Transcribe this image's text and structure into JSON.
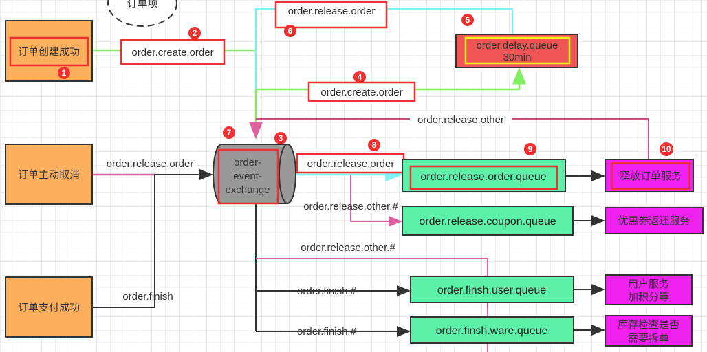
{
  "colors": {
    "producer": "#fbae5c",
    "queue": "#5cf0a8",
    "delay_queue": "#f05555",
    "service": "#f020f0",
    "exchange": "#999999",
    "highlight": "#f03030",
    "create_line": "#7fef5f",
    "release_line": "#7ff0f0",
    "other_line": "#e060a0"
  },
  "order_item": "订单项",
  "producers": [
    {
      "label": "订单创建成功",
      "badge": "1"
    },
    {
      "label": "订单主动取消"
    },
    {
      "label": "订单支付成功"
    }
  ],
  "exchange": {
    "line1": "order-",
    "line2": "event-",
    "line3": "exchange",
    "badge_left": "7",
    "badge_right": "3"
  },
  "delay_queue": {
    "line1": "order.delay.queue",
    "line2": "30min",
    "badge": "5"
  },
  "routes": {
    "create_from_producer": {
      "label": "order.create.order",
      "badge": "2"
    },
    "create_to_delay": {
      "label": "order.create.order",
      "badge": "4"
    },
    "delay_release": {
      "label": "order.release.order",
      "badge": "6"
    },
    "release_other_top": "order.release.other",
    "cancel_release": "order.release.order",
    "finish": "order.finish",
    "exchange_release": {
      "label": "order.release.order",
      "badge": "8"
    },
    "release_other_1": "order.release.other.#",
    "release_other_2": "order.release.other.#",
    "finish_user": "order.finish.#",
    "finish_ware": "order.finish.#"
  },
  "queues": [
    {
      "label": "order.release.order.queue",
      "badge": "9"
    },
    {
      "label": "order.release.coupon.queue"
    },
    {
      "label": "order.finsh.user.queue"
    },
    {
      "label": "order.finsh.ware.queue"
    }
  ],
  "services": [
    {
      "label": "释放订单服务",
      "badge": "10"
    },
    {
      "label": "优惠券返还服务"
    },
    {
      "line1": "用户服务",
      "line2": "加积分等"
    },
    {
      "line1": "库存检查是否",
      "line2": "需要拆单"
    }
  ]
}
